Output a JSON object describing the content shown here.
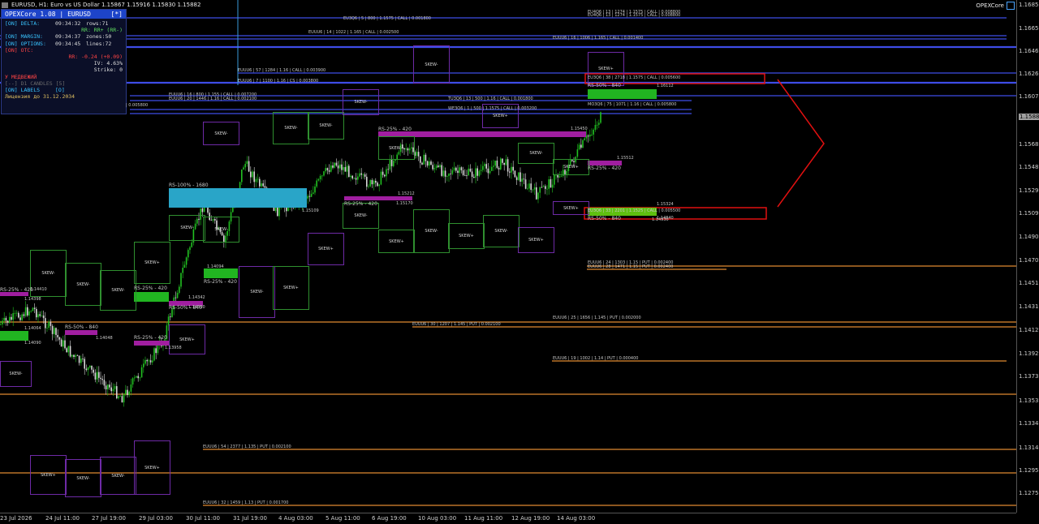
{
  "window": {
    "title": "EURUSD, H1:  Euro vs US Dollar  1.15867 1.15916 1.15830 1.15882",
    "brand": "OPEXCore"
  },
  "panel": {
    "title": "OPEXCore 1.08  |  EURUSD",
    "close": "[*]",
    "rows": [
      {
        "k": "[ON] DELTA:",
        "t": "09:34:32",
        "v": "rows:71"
      },
      {
        "k": "",
        "t": "RR: RR+ (RR-)",
        "v": ""
      },
      {
        "k": "[ON] MARGIN:",
        "t": "09:34:37",
        "v": "zones:50"
      },
      {
        "k": "[ON] OPTIONS:",
        "t": "09:34:45",
        "v": "lines:72"
      },
      {
        "k": "[ON] OTC:",
        "t": "",
        "v": ""
      },
      {
        "k": "",
        "t": "RR: -0.24 (+0.09)",
        "v": ""
      },
      {
        "k": "",
        "t": "IV: 4.63%",
        "v": ""
      },
      {
        "k": "",
        "t": "Strike: 0",
        "v": ""
      },
      {
        "k": "",
        "t": "У МЕДВЕЖИЙ",
        "v": ""
      },
      {
        "k": "[--] D1 CANDLES [5]",
        "t": "",
        "v": ""
      },
      {
        "k": "[ON] LABELS",
        "t": "[O]",
        "v": ""
      },
      {
        "k": "Лицензия до 31.12.2034",
        "t": "",
        "v": ""
      }
    ]
  },
  "price_axis": {
    "ticks": [
      "1.16850",
      "1.16655",
      "1.16460",
      "1.16265",
      "1.16070",
      "1.15680",
      "1.15485",
      "1.15290",
      "1.15095",
      "1.14900",
      "1.14705",
      "1.14510",
      "1.14315",
      "1.14120",
      "1.13925",
      "1.13730",
      "1.13535",
      "1.13340",
      "1.13145",
      "1.12950",
      "1.12755"
    ],
    "current": "1.15882"
  },
  "time_axis": {
    "ticks": [
      "23 Jul 2026",
      "24 Jul 11:00",
      "27 Jul 19:00",
      "29 Jul 03:00",
      "30 Jul 11:00",
      "31 Jul 19:00",
      "4 Aug 03:00",
      "5 Aug 11:00",
      "6 Aug 19:00",
      "10 Aug 03:00",
      "11 Aug 11:00",
      "12 Aug 19:00",
      "14 Aug 03:00"
    ]
  },
  "option_lines": [
    "EU3Q6 | 5 | 800 | 1.1575 | CALL | 0.001800",
    "EUUU6 | 14 | 1022 | 1.165 | CALL | 0.002500",
    "EUUU6 | 16 | 1006 | 1.165 | CALL | 0.001400",
    "EU4Q6 | 13 | 1274 | 1.1575 | CALL | 0.008800",
    "EU4Q6 | 13 | 1274 | 1.1575 | CALL | 0.008800",
    "EUUU6 | 57 | 1284 | 1.16 | CALL | 0.003900",
    "EUUU6 | 7 | 1100 | 1.16 | CS | 0.003800",
    "EU3Q6 | 38 | 2718 | 1.1575 | CALL | 0.005600",
    "EUUU6 | 16 | 800 | 1.155 | CALL | 0.007200",
    "EUUU6 | 20 | 1446 | 1.16 | CALL | 0.002100",
    "TU3Q6 | 13 | 500 | 1.16 | CALL | 0.001800",
    "WE3Q6 | 1 | 500 | 1.1575 | CALL | 0.003200",
    "MO3Q6 | 75 | 1071 | 1.16 | CALL | 0.005800",
    "| 0.005800",
    "EU3Q6 | 33 | 2201 | 1.1525 | CALL | 0.005500",
    "EUUU6 | 24 | 1303 | 1.15 | PUT | 0.002400",
    "EUUU6 | 28 | 1471 | 1.15 | PUT | 0.002400",
    "EUUU6 | 25 | 1656 | 1.145 | PUT | 0.002000",
    "EUUU6 | 30 | 1207 | 1.145 | PUT | 0.002100",
    "EUUU6 | 19 | 1002 | 1.14 | PUT | 0.000400",
    "EUUU6 | 54 | 2377 | 1.135 | PUT | 0.002100",
    "EUUU6 | 32 | 1459 | 1.13 | PUT | 0.001700"
  ],
  "rs_labels": [
    "RS-100% - 1680",
    "RS-25% - 420",
    "RS-25% - 420",
    "RS-50% - 840",
    "RS-50% - 840",
    "RS-25% - 420",
    "RS-25% - 420",
    "RS-25% - 420",
    "RS-25% - 420",
    "RS-50% - 840",
    "RS-50% - 840",
    "RS-25% - 420"
  ],
  "price_tags": [
    "1.15512",
    "1.15212",
    "1.15170",
    "1.16112",
    "1.15450",
    "1.15324",
    "1.14840",
    "1.14342",
    "1.14300",
    "1.14410",
    "1.14398",
    "1.14064",
    "1.14090",
    "1.14048",
    "1.13958",
    "1.14094",
    "1.15109",
    "1.14930"
  ],
  "skew_labels": [
    "SKEW+",
    "SKEW-"
  ],
  "colors": {
    "call": "#3e4ce6",
    "put": "#e08a30",
    "accent": "#1d44c9",
    "highlight": "#e01010",
    "bull": "#21c021",
    "bear": "#d8d8d8"
  }
}
